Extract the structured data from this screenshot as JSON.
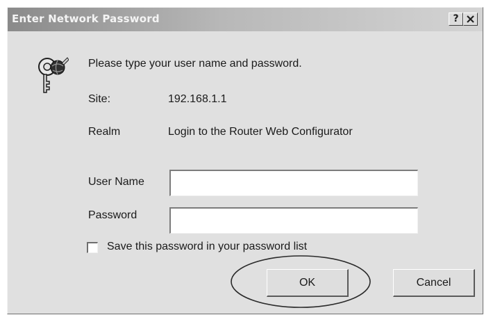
{
  "dialog": {
    "title": "Enter Network Password",
    "help_button": "?",
    "close_button": "✕"
  },
  "prompt": "Please type your user name and password.",
  "site": {
    "label": "Site:",
    "value": "192.168.1.1"
  },
  "realm": {
    "label": "Realm",
    "value": "Login to the Router Web Configurator"
  },
  "user_name": {
    "label": "User Name",
    "value": ""
  },
  "password": {
    "label": "Password",
    "value": ""
  },
  "save_password": {
    "label": "Save this password in your password list",
    "checked": false
  },
  "buttons": {
    "ok": "OK",
    "cancel": "Cancel"
  },
  "icons": {
    "credentials": "key-icon",
    "highlight": "ellipse-annotation"
  }
}
